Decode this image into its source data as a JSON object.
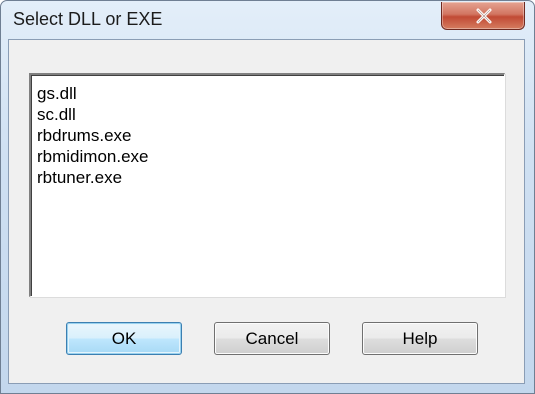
{
  "window": {
    "title": "Select DLL or EXE"
  },
  "listbox": {
    "items": [
      "gs.dll",
      "sc.dll",
      "rbdrums.exe",
      "rbmidimon.exe",
      "rbtuner.exe"
    ]
  },
  "buttons": {
    "ok_label": "OK",
    "cancel_label": "Cancel",
    "help_label": "Help"
  },
  "icons": {
    "close": "close-icon"
  },
  "colors": {
    "close_button": "#c14a35",
    "default_button_border": "#3c7fb1",
    "title_bar": "#cfe0f2"
  }
}
